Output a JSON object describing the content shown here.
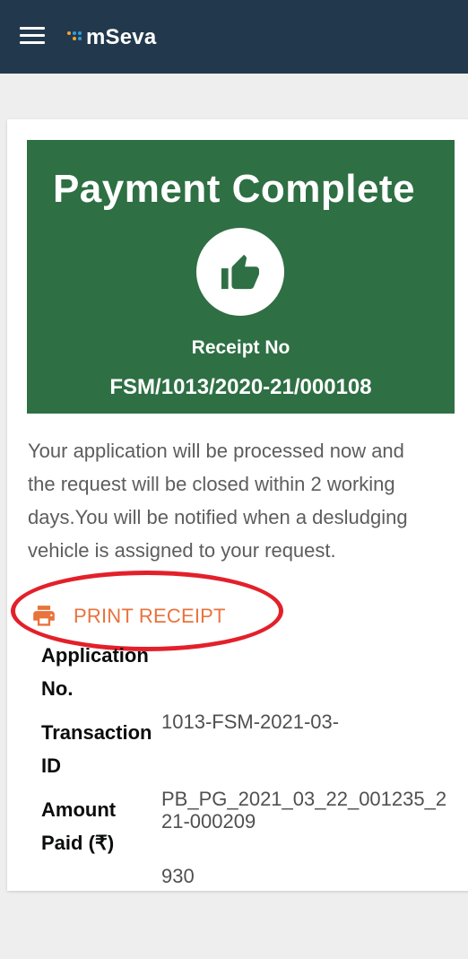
{
  "header": {
    "app_name": "mSeva",
    "menu_icon": "hamburger-menu-icon",
    "logo_icon": "mseva-dots-logo-icon"
  },
  "banner": {
    "title": "Payment Complete",
    "icon": "thumbs-up-icon",
    "receipt_label": "Receipt No",
    "receipt_number": "FSM/1013/2020-21/000108",
    "color": "#2e6f44"
  },
  "message": {
    "line1": "Your application will be processed now and",
    "line2": "the request will be closed within 2 working",
    "line3": "days.You will be notified when a desludging",
    "line4": "vehicle is assigned to your request."
  },
  "actions": {
    "print_receipt_label": "PRINT RECEIPT",
    "print_icon": "printer-icon",
    "accent_color": "#e8733c"
  },
  "details": {
    "application_no": {
      "label_line1": "Application",
      "label_line2": "No.",
      "value_line1": "1013-FSM-2021-03-",
      "value_line2": "21-000209"
    },
    "transaction_id": {
      "label_line1": "Transaction",
      "label_line2": "ID",
      "value_line1": "PB_PG_2021_03_22_001235_2"
    },
    "amount_paid": {
      "label_line1": "Amount",
      "label_line2": "Paid (₹)",
      "value_line1": "930"
    }
  },
  "annotation": {
    "highlight_color": "#e3202a"
  }
}
